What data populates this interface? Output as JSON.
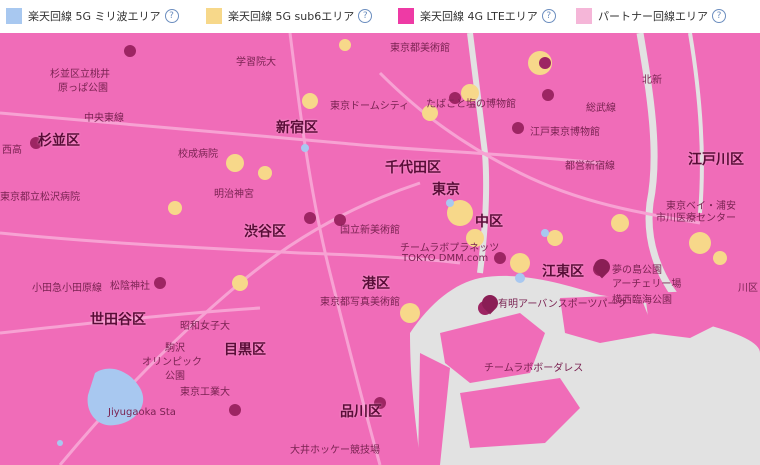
{
  "legend": {
    "items": [
      {
        "label": "楽天回線 5G ミリ波エリア",
        "color": "#a8c8f0"
      },
      {
        "label": "楽天回線 5G sub6エリア",
        "color": "#f7d88a"
      },
      {
        "label": "楽天回線 4G LTEエリア",
        "color": "#ee3aa5"
      },
      {
        "label": "パートナー回線エリア",
        "color": "#f5b6d8"
      }
    ],
    "help_symbol": "?"
  },
  "map": {
    "land_color": "#f06cb8",
    "water_color": "#e2e2e2",
    "wards": {
      "suginami": "杉並区",
      "shinjuku": "新宿区",
      "chiyoda": "千代田区",
      "shibuya": "渋谷区",
      "minato": "港区",
      "setagaya": "世田谷区",
      "meguro": "目黒区",
      "shinagawa": "品川区",
      "koto": "江東区",
      "edogawa": "江戸川区",
      "chuo": "中区",
      "tokyo": "東京"
    },
    "places": {
      "p1": "杉並区立桃井",
      "p2": "原っぱ公園",
      "p3": "中央東線",
      "p4": "東京都立松沢病院",
      "p5": "小田急小田原線",
      "p6": "駒沢",
      "p7": "オリンピック",
      "p8": "公園",
      "p9": "Jiyugaoka Sta",
      "p10": "大井ホッケー競技場",
      "p11": "東京工業大",
      "p12": "昭和女子大",
      "p13": "明治神宮",
      "p14": "国立新美術館",
      "p15": "東京都写真美術館",
      "p16": "東京ドームシティ",
      "p17": "江戸東京博物館",
      "p18": "たばこと塩の博物館",
      "p19": "東京都美術館",
      "p20": "都営新宿線",
      "p21": "チームラボプラネッツ",
      "p22": "TOKYO DMM.com",
      "p23": "有明アーバンスポーツパーク",
      "p24": "チームラボボーダレス",
      "p25": "夢の島公園",
      "p26": "アーチェリー場",
      "p27": "横西臨海公園",
      "p28": "東京ベイ・浦安",
      "p29": "市川医療センター",
      "p30": "西高",
      "p31": "学習院大",
      "p32": "校成病院",
      "p33": "北新",
      "p34": "松陰神社",
      "p35": "総武線",
      "p36": "川区"
    }
  }
}
